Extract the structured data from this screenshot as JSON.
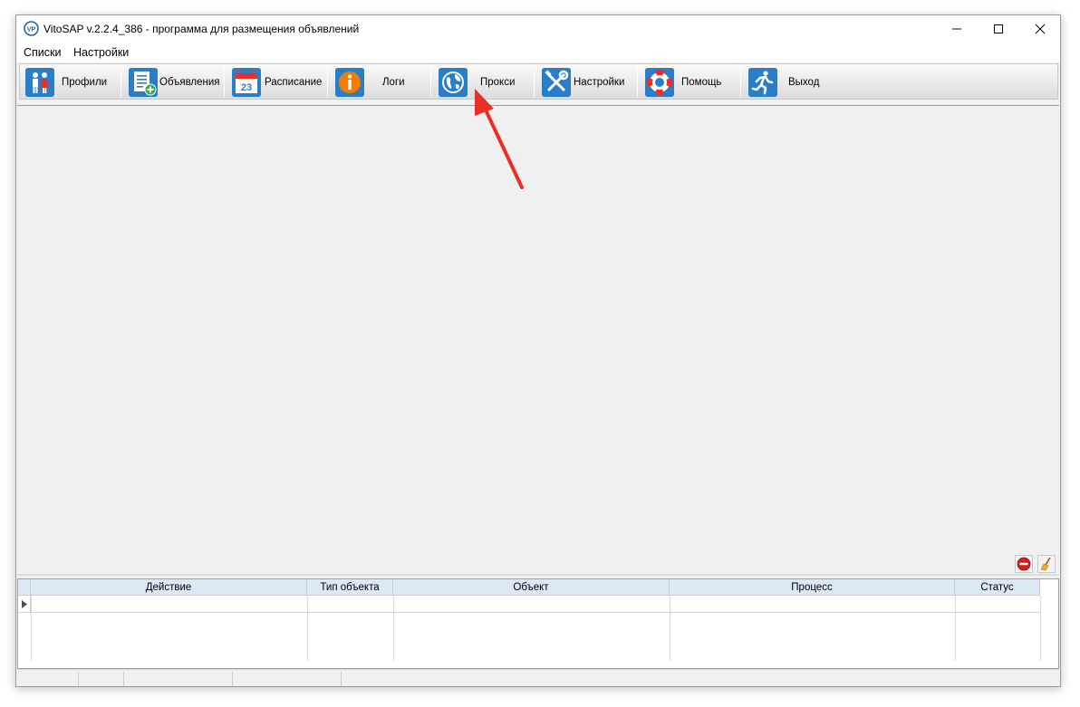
{
  "window": {
    "title": "VitoSAP v.2.2.4_386 - программа для размещения объявлений",
    "app_icon_text": "VP"
  },
  "menu": {
    "items": [
      "Списки",
      "Настройки"
    ]
  },
  "toolbar": {
    "buttons": [
      {
        "label": "Профили",
        "icon": "profiles-icon"
      },
      {
        "label": "Объявления",
        "icon": "ads-icon"
      },
      {
        "label": "Расписание",
        "icon": "calendar-icon"
      },
      {
        "label": "Логи",
        "icon": "info-icon"
      },
      {
        "label": "Прокси",
        "icon": "globe-icon"
      },
      {
        "label": "Настройки",
        "icon": "tools-icon"
      },
      {
        "label": "Помощь",
        "icon": "lifebuoy-icon"
      },
      {
        "label": "Выход",
        "icon": "exit-icon"
      }
    ],
    "calendar_day": "23"
  },
  "log_grid": {
    "columns": [
      "Действие",
      "Тип объекта",
      "Объект",
      "Процесс",
      "Статус"
    ],
    "rows": []
  },
  "colors": {
    "icon_blue": "#2a7ec8",
    "annotation_arrow": "#e8302a",
    "grid_header": "#dce9f5"
  }
}
